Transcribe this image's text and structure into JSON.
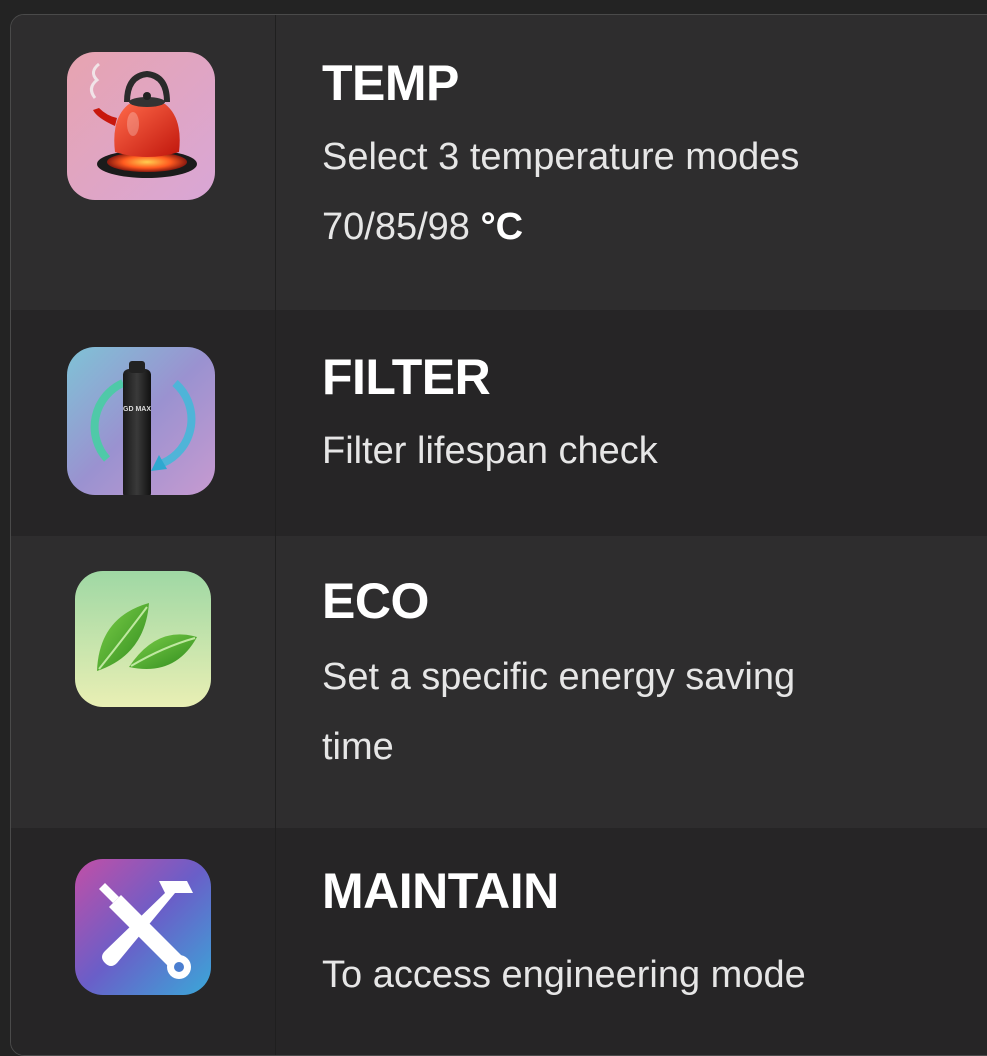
{
  "features": [
    {
      "id": "temp",
      "title": "TEMP",
      "description_line1": "Select 3 temperature modes",
      "description_line2": "70/85/98",
      "description_unit": "°C",
      "icon": "kettle-icon"
    },
    {
      "id": "filter",
      "title": "FILTER",
      "description": "Filter lifespan check",
      "icon": "filter-cartridge-icon",
      "icon_text": "GD MAX"
    },
    {
      "id": "eco",
      "title": "ECO",
      "description_line1": "Set a specific energy saving",
      "description_line2": "time",
      "icon": "leaf-icon"
    },
    {
      "id": "maintain",
      "title": "MAINTAIN",
      "description": "To access engineering mode",
      "icon": "tools-icon"
    }
  ],
  "colors": {
    "row_dark": "#262526",
    "row_light": "#2e2d2e",
    "title": "#ffffff",
    "text": "#e6e6e6"
  }
}
